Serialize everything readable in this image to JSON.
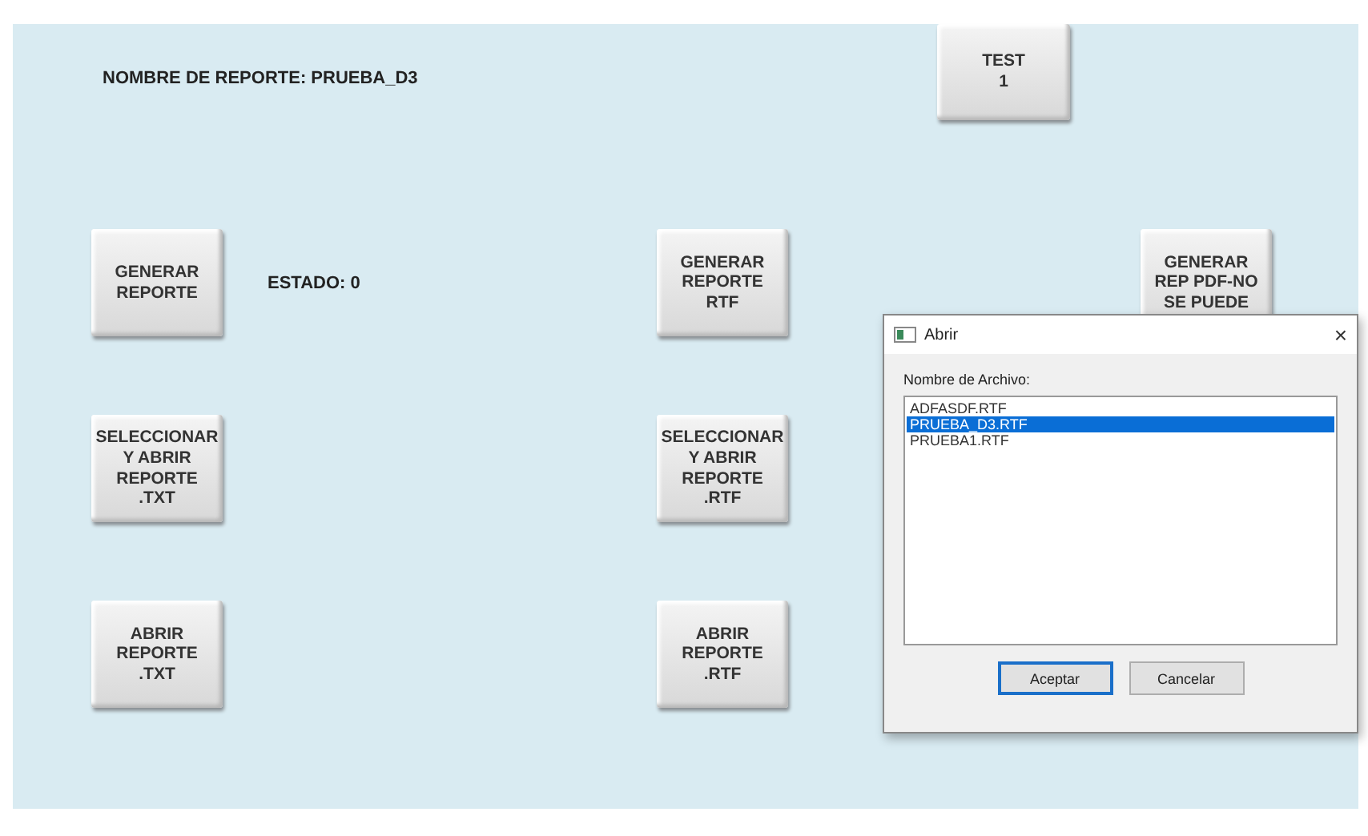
{
  "report_name_label": "NOMBRE DE REPORTE: PRUEBA_D3",
  "test_button": "TEST\n1",
  "status_label": "ESTADO: 0",
  "buttons": [
    "GENERAR\nREPORTE",
    "GENERAR\nREPORTE\nRTF",
    "GENERAR\nREP PDF-NO\nSE PUEDE",
    "SELECCIONAR\nY ABRIR\nREPORTE\n.TXT",
    "SELECCIONAR\nY ABRIR\nREPORTE\n.RTF",
    "ABRIR\nREPORTE\n.TXT",
    "ABRIR\nREPORTE\n.RTF"
  ],
  "dialog": {
    "title": "Abrir",
    "close": "×",
    "field_label": "Nombre de Archivo:",
    "files": [
      {
        "name": "ADFASDF.RTF",
        "selected": false
      },
      {
        "name": "PRUEBA_D3.RTF",
        "selected": true
      },
      {
        "name": "PRUEBA1.RTF",
        "selected": false
      }
    ],
    "buttons": [
      {
        "label": "Aceptar",
        "focused": true
      },
      {
        "label": "Cancelar",
        "focused": false
      }
    ]
  }
}
